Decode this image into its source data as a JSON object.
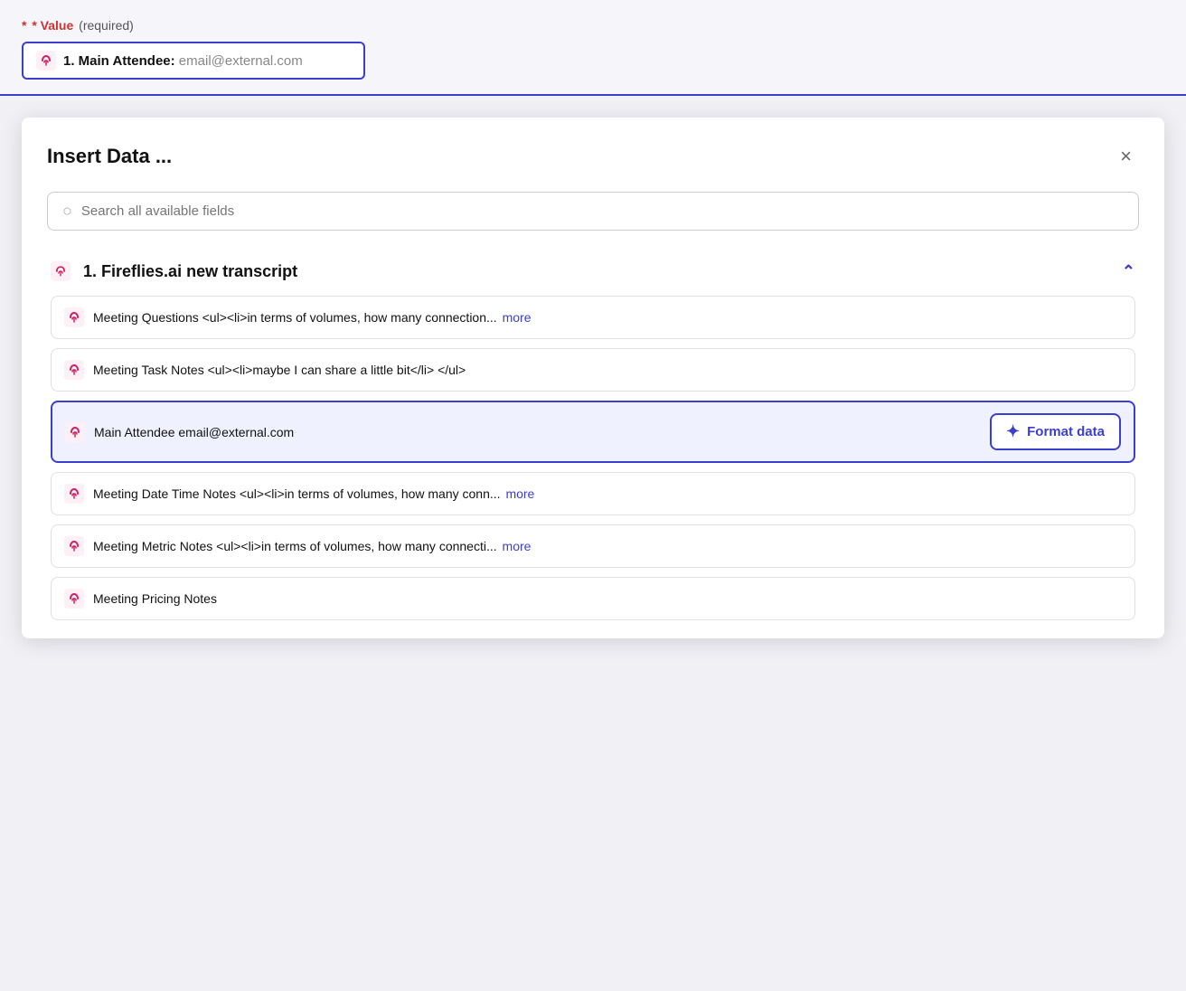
{
  "top_bar": {
    "value_label": "* Value",
    "required_label": "(required)",
    "input_text": "1. Main Attendee:",
    "input_placeholder": " email@external.com"
  },
  "modal": {
    "title": "Insert Data ...",
    "close_label": "×",
    "search_placeholder": "Search all available fields",
    "section": {
      "number": "1.",
      "title": "Fireflies.ai new transcript",
      "items": [
        {
          "id": "meeting-questions",
          "label": "Meeting Questions <ul><li>in terms of volumes, how many connection...",
          "has_more": true,
          "selected": false
        },
        {
          "id": "meeting-task-notes",
          "label": "Meeting Task Notes <ul><li>maybe I can share a little bit</li> </ul>",
          "has_more": false,
          "selected": false
        },
        {
          "id": "main-attendee",
          "label": "Main Attendee email@external.com",
          "has_more": false,
          "selected": true,
          "has_format_btn": true,
          "format_btn_label": "Format data"
        },
        {
          "id": "meeting-date-time-notes",
          "label": "Meeting Date Time Notes <ul><li>in terms of volumes, how many conn...",
          "has_more": true,
          "selected": false
        },
        {
          "id": "meeting-metric-notes",
          "label": "Meeting Metric Notes <ul><li>in terms of volumes, how many connecti...",
          "has_more": true,
          "selected": false
        },
        {
          "id": "meeting-pricing-notes",
          "label": "Meeting Pricing Notes",
          "has_more": false,
          "selected": false
        }
      ]
    }
  }
}
